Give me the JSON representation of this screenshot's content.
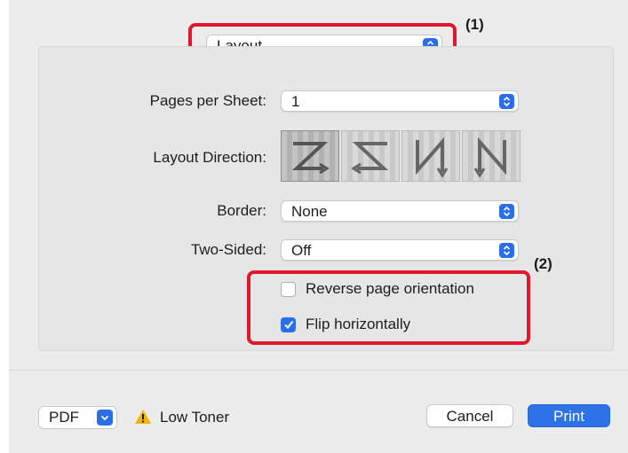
{
  "header": {
    "presets_popup": "Layout"
  },
  "callouts": {
    "one": "(1)",
    "two": "(2)"
  },
  "layout": {
    "pages_per_sheet_label": "Pages per Sheet:",
    "pages_per_sheet_value": "1",
    "layout_direction_label": "Layout Direction:",
    "layout_direction_options": [
      "z-left-to-right-icon",
      "reverse-z-icon",
      "n-top-to-bottom-icon",
      "reverse-n-icon"
    ],
    "layout_direction_selected": 0,
    "border_label": "Border:",
    "border_value": "None",
    "two_sided_label": "Two-Sided:",
    "two_sided_value": "Off"
  },
  "options": {
    "reverse_orientation_label": "Reverse page orientation",
    "reverse_orientation_checked": false,
    "flip_horizontally_label": "Flip horizontally",
    "flip_horizontally_checked": true
  },
  "footer": {
    "pdf_label": "PDF",
    "warning_text": "Low Toner",
    "cancel_label": "Cancel",
    "print_label": "Print"
  },
  "colors": {
    "accent": "#2a6ee8",
    "highlight": "#e0182e",
    "warning": "#f5b400"
  }
}
